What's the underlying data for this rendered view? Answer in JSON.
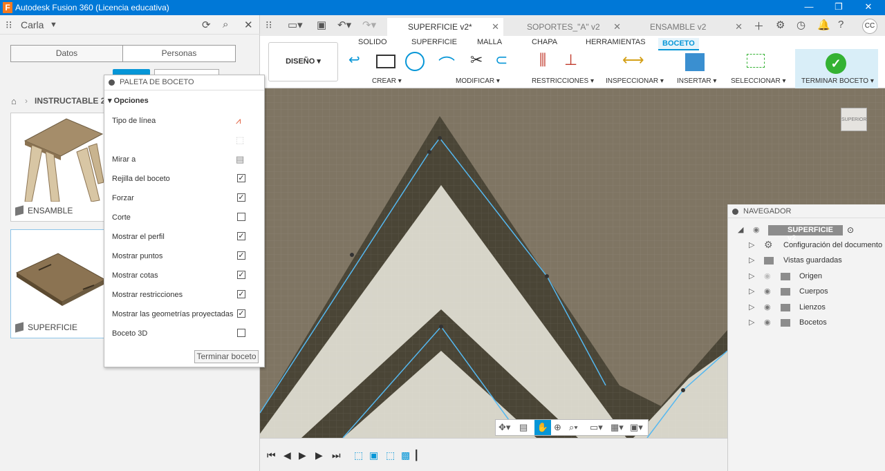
{
  "window": {
    "title": "Autodesk Fusion 360 (Licencia educativa)",
    "logo_letter": "F",
    "minimize": "—",
    "restore": "❐",
    "close": "✕"
  },
  "data_panel": {
    "user": "Carla",
    "tabs": [
      "Datos",
      "Personas"
    ],
    "breadcrumb": "INSTRUCTABLE 2",
    "files": [
      {
        "name": "ENSAMBLE"
      },
      {
        "name": "SUPERFICIE"
      }
    ]
  },
  "palette": {
    "title": "PALETA DE BOCETO",
    "section": "Opciones",
    "options": [
      {
        "label": "Tipo de línea",
        "kind": "icon"
      },
      {
        "label": "",
        "kind": "icon"
      },
      {
        "label": "Mirar a",
        "kind": "icon"
      },
      {
        "label": "Rejilla del boceto",
        "checked": true
      },
      {
        "label": "Forzar",
        "checked": true
      },
      {
        "label": "Corte",
        "checked": false
      },
      {
        "label": "Mostrar el perfil",
        "checked": true
      },
      {
        "label": "Mostrar puntos",
        "checked": true
      },
      {
        "label": "Mostrar cotas",
        "checked": true
      },
      {
        "label": "Mostrar restricciones",
        "checked": true
      },
      {
        "label": "Mostrar las geometrías proyectadas",
        "checked": true
      },
      {
        "label": "Boceto 3D",
        "checked": false
      }
    ],
    "finish_button": "Terminar boceto"
  },
  "doc_tabs": [
    {
      "label": "SUPERFICIE v2*",
      "active": true
    },
    {
      "label": "SOPORTES_\"A\" v2",
      "active": false
    },
    {
      "label": "ENSAMBLE v2",
      "active": false
    }
  ],
  "ribbon": {
    "workspace": "DISEÑO",
    "workspace_tabs": [
      "SOLIDO",
      "SUPERFICIE",
      "MALLA",
      "CHAPA",
      "HERRAMIENTAS",
      "BOCETO"
    ],
    "active_tab": "BOCETO",
    "groups": [
      "CREAR",
      "MODIFICAR",
      "RESTRICCIONES",
      "INSPECCIONAR",
      "INSERTAR",
      "SELECCIONAR",
      "TERMINAR BOCETO"
    ],
    "finish_color": "#34b233",
    "accent": "#0696d7"
  },
  "viewcube": {
    "face": "SUPERIOR"
  },
  "navigator": {
    "title": "NAVEGADOR",
    "root": "SUPERFICIE v2",
    "items": [
      "Configuración del documento",
      "Vistas guardadas",
      "Origen",
      "Cuerpos",
      "Lienzos",
      "Bocetos"
    ]
  },
  "user_initials": "CC"
}
